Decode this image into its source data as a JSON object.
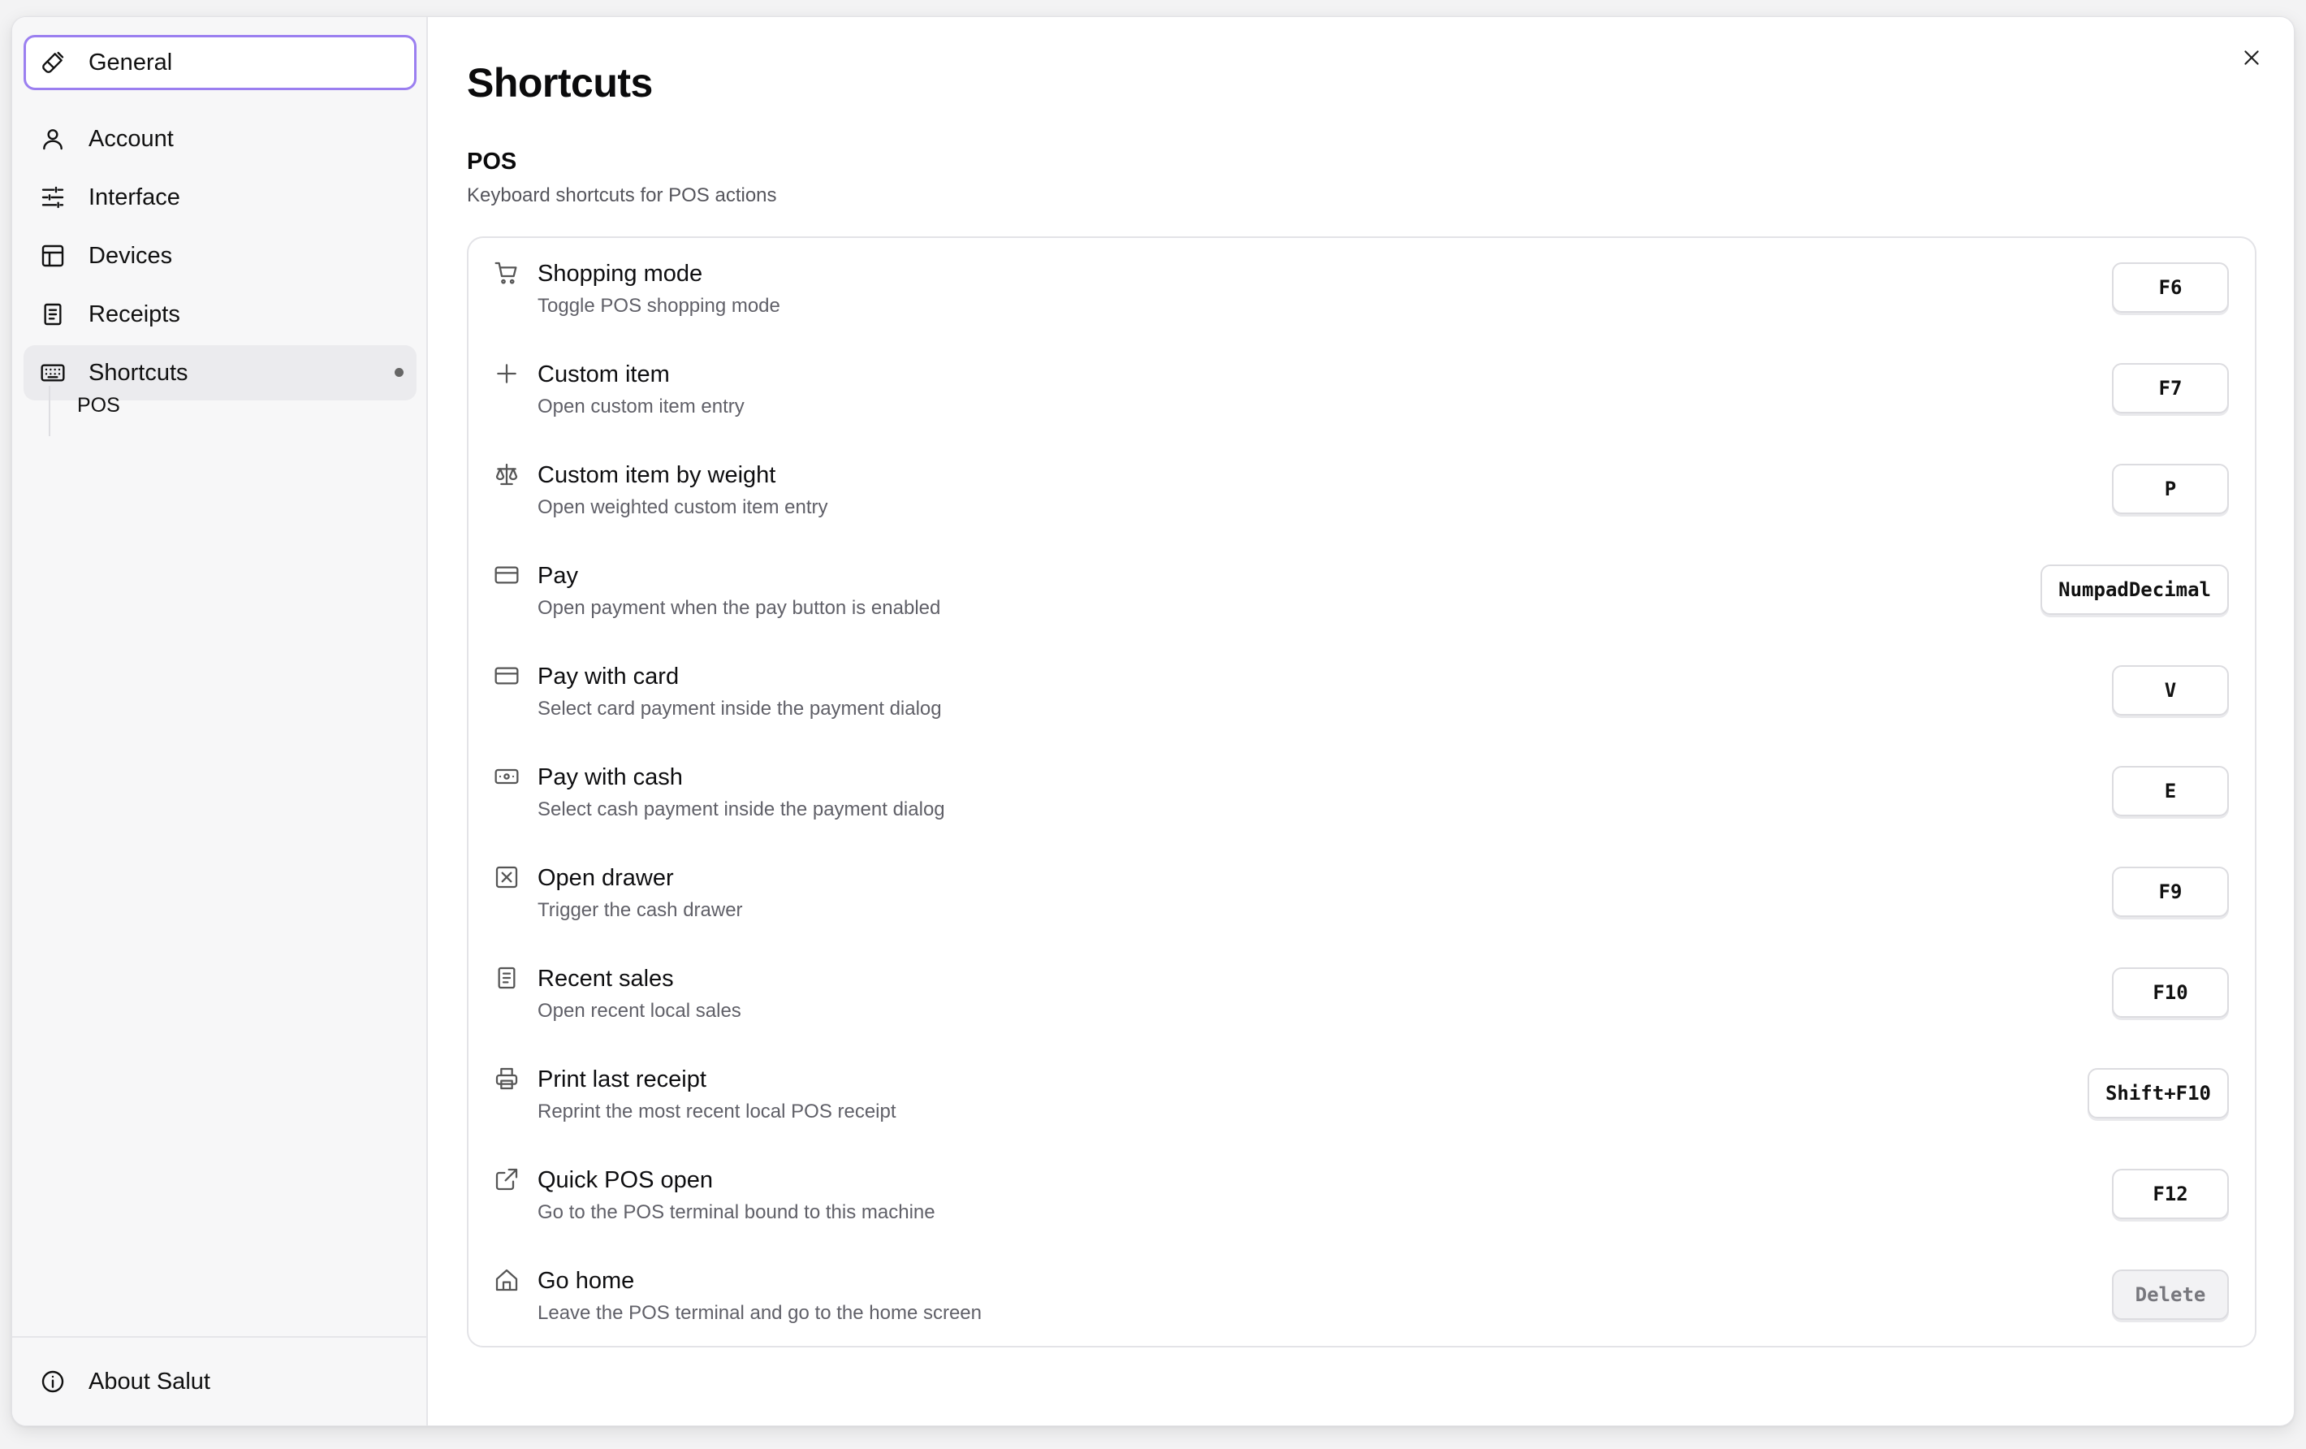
{
  "sidebar": {
    "items": [
      {
        "label": "General",
        "icon": "brush-icon"
      },
      {
        "label": "Account",
        "icon": "user-icon"
      },
      {
        "label": "Interface",
        "icon": "sliders-icon"
      },
      {
        "label": "Devices",
        "icon": "layout-icon"
      },
      {
        "label": "Receipts",
        "icon": "receipt-icon"
      },
      {
        "label": "Shortcuts",
        "icon": "keyboard-icon"
      }
    ],
    "subitems": [
      {
        "label": "POS"
      }
    ],
    "footer": {
      "label": "About Salut",
      "icon": "info-icon"
    }
  },
  "header": {
    "title": "Shortcuts",
    "close_icon": "close-icon"
  },
  "section": {
    "title": "POS",
    "description": "Keyboard shortcuts for POS actions"
  },
  "shortcuts": [
    {
      "title": "Shopping mode",
      "description": "Toggle POS shopping mode",
      "key": "F6",
      "icon": "cart-icon"
    },
    {
      "title": "Custom item",
      "description": "Open custom item entry",
      "key": "F7",
      "icon": "plus-icon"
    },
    {
      "title": "Custom item by weight",
      "description": "Open weighted custom item entry",
      "key": "P",
      "icon": "scale-icon"
    },
    {
      "title": "Pay",
      "description": "Open payment when the pay button is enabled",
      "key": "NumpadDecimal",
      "icon": "credit-card-icon"
    },
    {
      "title": "Pay with card",
      "description": "Select card payment inside the payment dialog",
      "key": "V",
      "icon": "credit-card-icon"
    },
    {
      "title": "Pay with cash",
      "description": "Select cash payment inside the payment dialog",
      "key": "E",
      "icon": "banknote-icon"
    },
    {
      "title": "Open drawer",
      "description": "Trigger the cash drawer",
      "key": "F9",
      "icon": "drawer-icon"
    },
    {
      "title": "Recent sales",
      "description": "Open recent local sales",
      "key": "F10",
      "icon": "receipt-icon"
    },
    {
      "title": "Print last receipt",
      "description": "Reprint the most recent local POS receipt",
      "key": "Shift+F10",
      "icon": "printer-icon"
    },
    {
      "title": "Quick POS open",
      "description": "Go to the POS terminal bound to this machine",
      "key": "F12",
      "icon": "external-link-icon"
    },
    {
      "title": "Go home",
      "description": "Leave the POS terminal and go to the home screen",
      "key": "Delete",
      "icon": "home-icon"
    }
  ],
  "colors": {
    "selected_border": "#9b7ff0",
    "sidebar_bg": "#f7f7f8",
    "current_bg": "#ebebee"
  }
}
